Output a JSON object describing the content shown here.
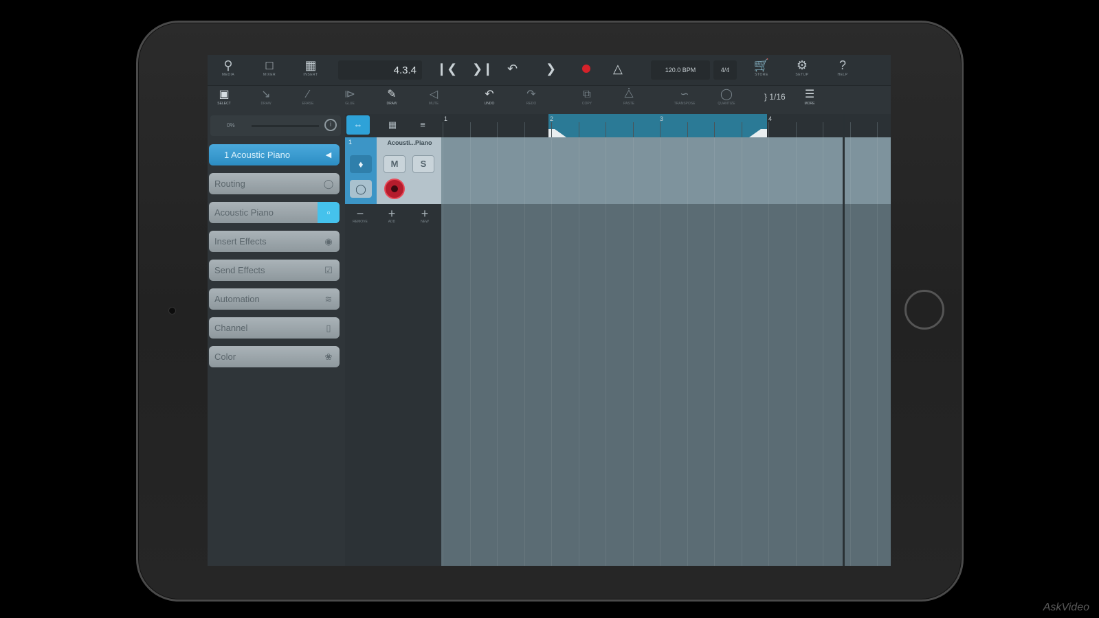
{
  "toolbar": {
    "buttons": [
      {
        "icon": "browser-icon",
        "label": "MEDIA"
      },
      {
        "icon": "mixer-icon",
        "label": "MIXER"
      },
      {
        "icon": "inspector-icon",
        "label": "INSERT"
      }
    ],
    "position": "4.3.4",
    "tempo": "120.0 BPM",
    "signature": "4/4",
    "right_buttons": [
      {
        "icon": "cart-icon",
        "label": "STORE"
      },
      {
        "icon": "gear-icon",
        "label": "SETUP"
      },
      {
        "icon": "help-icon",
        "label": "HELP"
      }
    ]
  },
  "tools": [
    {
      "label": "SELECT",
      "icon": "select-icon",
      "active": true
    },
    {
      "label": "DRAW",
      "icon": "draw-icon",
      "active": false
    },
    {
      "label": "ERASE",
      "icon": "erase-icon",
      "active": false
    },
    {
      "label": "GLUE",
      "icon": "glue-icon",
      "active": false
    },
    {
      "label": "DRAW",
      "icon": "pencil-icon",
      "active": true
    },
    {
      "label": "MUTE",
      "icon": "mute-icon",
      "active": false
    },
    {
      "label": "UNDO",
      "icon": "undo-icon",
      "active": true
    },
    {
      "label": "REDO",
      "icon": "redo-icon",
      "active": false
    },
    {
      "label": "COPY",
      "icon": "copy-icon",
      "active": false
    },
    {
      "label": "PASTE",
      "icon": "paste-icon",
      "active": false
    },
    {
      "label": "TRANSPOSE",
      "icon": "transpose-icon",
      "active": false
    },
    {
      "label": "QUANTIZE",
      "icon": "quantize-icon",
      "active": false
    },
    {
      "label": "MORE",
      "icon": "more-icon",
      "active": true
    }
  ],
  "quantize": "1/16",
  "inspector": {
    "volume_pct": "0%",
    "items": [
      {
        "label": "1  Acoustic Piano",
        "icon": "collapse-icon"
      },
      {
        "label": "Routing",
        "icon": "routing-icon"
      },
      {
        "label": "Acoustic Piano",
        "icon": "instrument-icon"
      },
      {
        "label": "Insert Effects",
        "icon": "insert-icon"
      },
      {
        "label": "Send Effects",
        "icon": "send-icon"
      },
      {
        "label": "Automation",
        "icon": "automation-icon"
      },
      {
        "label": "Channel",
        "icon": "channel-icon"
      },
      {
        "label": "Color",
        "icon": "color-icon"
      }
    ]
  },
  "tracklist": {
    "track_number": "1",
    "track_name": "Acousti...Piano",
    "mute": "M",
    "solo": "S",
    "buttons": [
      {
        "icon": "minus",
        "label": "REMOVE"
      },
      {
        "icon": "plus",
        "label": "ADD"
      },
      {
        "icon": "plus",
        "label": "NEW"
      }
    ]
  },
  "ruler": {
    "bars": [
      "1",
      "2",
      "3",
      "4"
    ]
  },
  "watermark": "AskVideo"
}
